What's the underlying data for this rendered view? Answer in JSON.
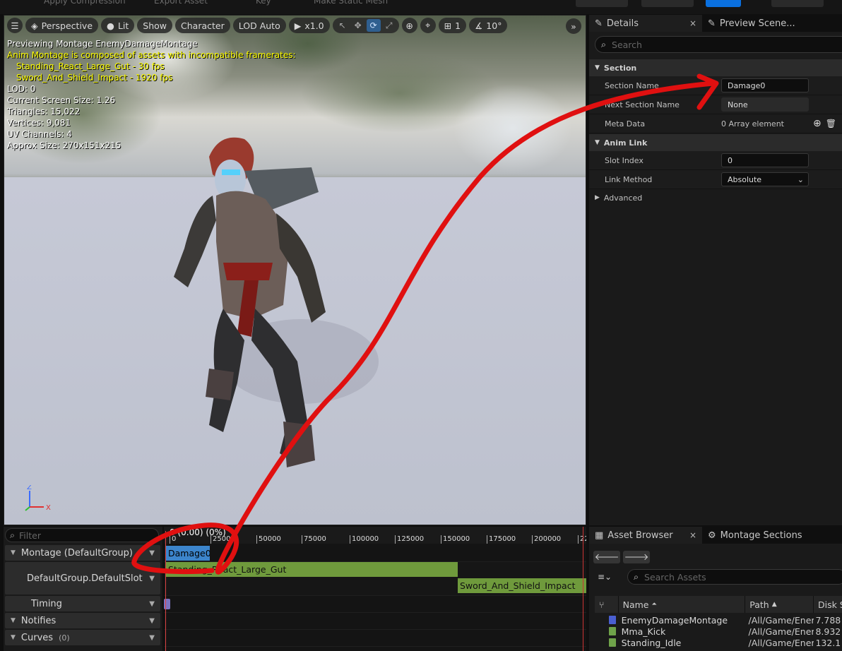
{
  "topbar": {
    "items": [
      "Apply Compression",
      "Export Asset",
      "Key",
      "Make Static Mesh"
    ]
  },
  "viewport": {
    "toolbar": {
      "perspective": "Perspective",
      "lit": "Lit",
      "show": "Show",
      "character": "Character",
      "lod": "LOD Auto",
      "play_speed": "x1.0",
      "grid_size": "1",
      "rotation_snap": "10°"
    },
    "overlay": {
      "line1": "Previewing Montage EnemyDamageMontage",
      "warning": "Anim Montage is composed of assets with incompatible framerates:",
      "asset1": "Standing_React_Large_Gut - 30 fps",
      "asset2": "Sword_And_Shield_Impact - 1920 fps",
      "lod": "LOD: 0",
      "screen_size": "Current Screen Size: 1.26",
      "triangles": "Triangles: 15,022",
      "vertices": "Vertices: 9,081",
      "uv": "UV Channels: 4",
      "approx": "Approx Size: 270x151x215"
    },
    "axis": {
      "z": "Z",
      "x": "X"
    }
  },
  "details": {
    "tabs": [
      {
        "label": "Details",
        "close": "×"
      },
      {
        "label": "Preview Scene..."
      }
    ],
    "search_placeholder": "Search",
    "section_title": "Section",
    "rows": {
      "section_name_label": "Section Name",
      "section_name_value": "Damage0",
      "next_section_label": "Next Section Name",
      "next_section_value": "None",
      "meta_label": "Meta Data",
      "meta_value": "0 Array element"
    },
    "anim_link_title": "Anim Link",
    "anim_rows": {
      "slot_index_label": "Slot Index",
      "slot_index_value": "0",
      "link_method_label": "Link Method",
      "link_method_value": "Absolute"
    },
    "advanced": "Advanced"
  },
  "timeline": {
    "filter_placeholder": "Filter",
    "tracks": {
      "montage": "Montage (DefaultGroup)",
      "slot": "DefaultGroup.DefaultSlot",
      "timing": "Timing",
      "notifies": "Notifies",
      "curves": "Curves",
      "curves_count": "(0)"
    },
    "playhead": "0 (0.00) (0%)",
    "ticks": [
      "0",
      "25000",
      "50000",
      "75000",
      "100000",
      "125000",
      "150000",
      "175000",
      "200000",
      "22"
    ],
    "section": "Damage0",
    "seg1": "Standing_React_Large_Gut",
    "seg2": "Sword_And_Shield_Impact"
  },
  "asset_browser": {
    "tabs": [
      {
        "label": "Asset Browser",
        "close": "×"
      },
      {
        "label": "Montage Sections"
      }
    ],
    "search_placeholder": "Search Assets",
    "columns": {
      "name": "Name",
      "path": "Path",
      "disk": "Disk S"
    },
    "rows": [
      {
        "name": "EnemyDamageMontage",
        "path": "/All/Game/Ener",
        "disk": "7.788"
      },
      {
        "name": "Mma_Kick",
        "path": "/All/Game/Ener",
        "disk": "8.932"
      },
      {
        "name": "Standing_Idle",
        "path": "/All/Game/Ener",
        "disk": "132.1"
      }
    ]
  },
  "colors": {
    "accent_blue": "#0a70e0",
    "section_blue": "#3c85cc",
    "segment_green": "#6f9a3c",
    "annotation_red": "#e01010",
    "warning_yellow": "#ffff00"
  }
}
